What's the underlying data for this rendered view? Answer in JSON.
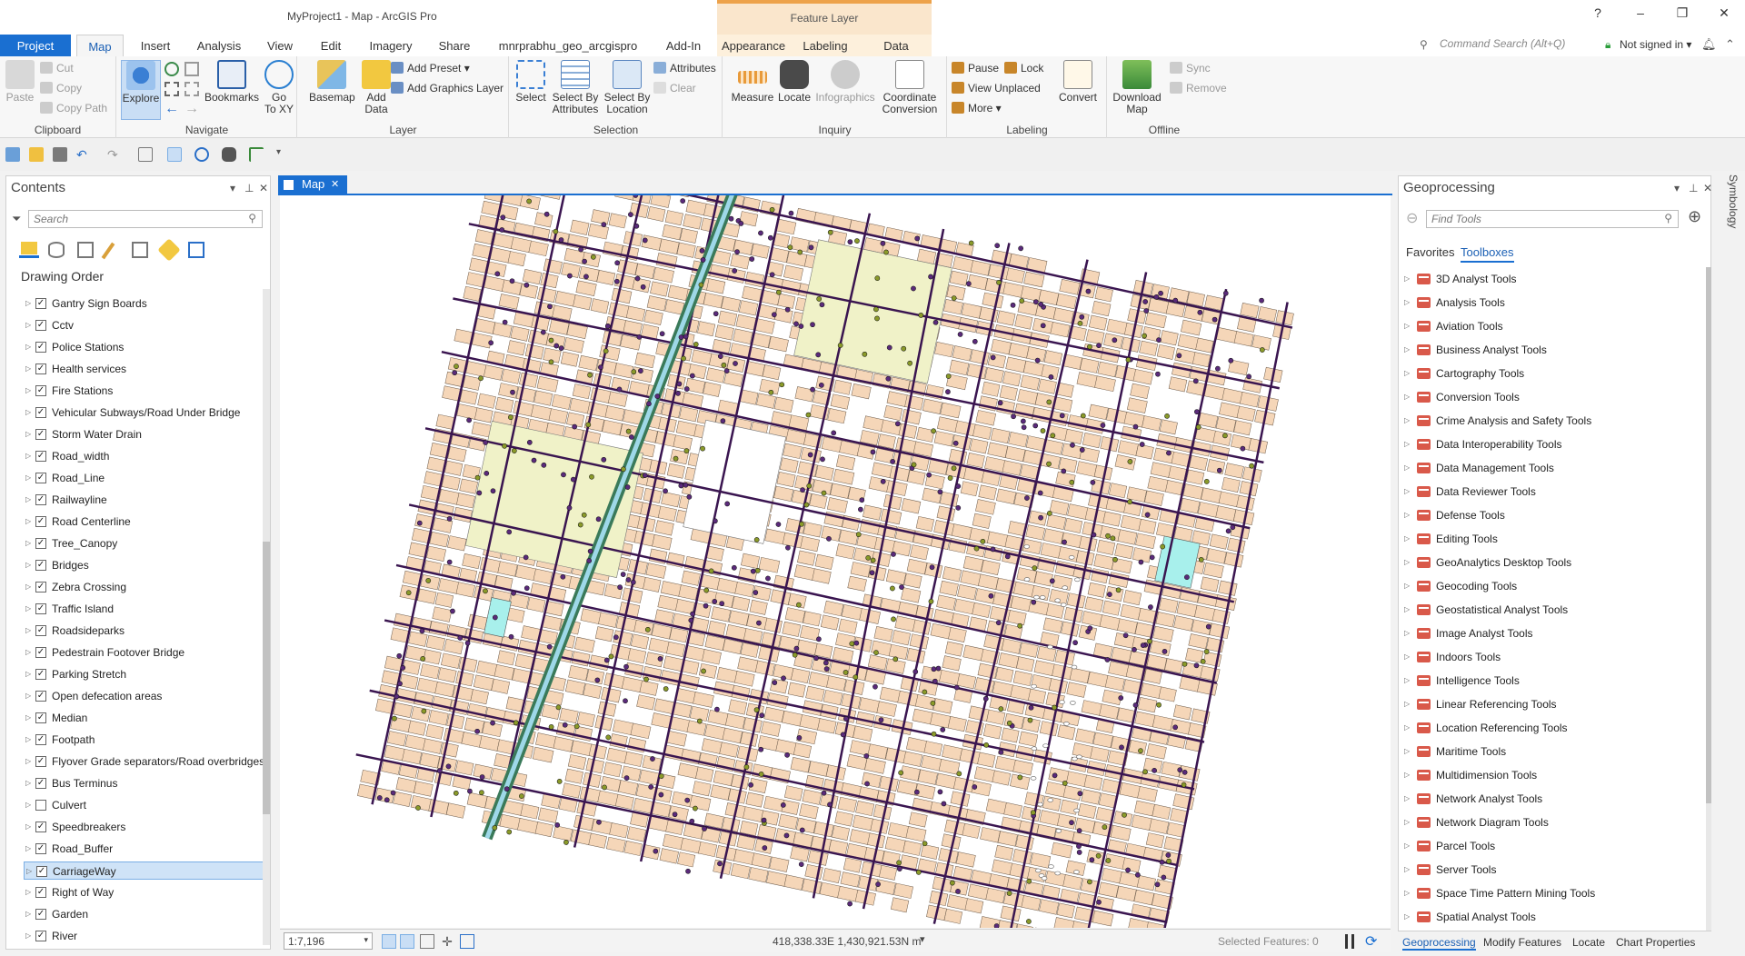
{
  "window": {
    "title": "MyProject1 - Map - ArcGIS Pro",
    "context_header": "Feature Layer",
    "help": "?",
    "minimize": "–",
    "restore": "❐",
    "close": "✕"
  },
  "tabs": [
    {
      "label": "Project"
    },
    {
      "label": "Map"
    },
    {
      "label": "Insert"
    },
    {
      "label": "Analysis"
    },
    {
      "label": "View"
    },
    {
      "label": "Edit"
    },
    {
      "label": "Imagery"
    },
    {
      "label": "Share"
    },
    {
      "label": "mnrprabhu_geo_arcgispro"
    },
    {
      "label": "Add-In"
    },
    {
      "label": "Appearance"
    },
    {
      "label": "Labeling"
    },
    {
      "label": "Data"
    }
  ],
  "command_search": {
    "placeholder": "Command Search (Alt+Q)"
  },
  "account": {
    "label": "Not signed in"
  },
  "ribbon": {
    "clipboard": {
      "label": "Clipboard",
      "paste": "Paste",
      "cut": "Cut",
      "copy": "Copy",
      "copy_path": "Copy Path"
    },
    "navigate": {
      "label": "Navigate",
      "explore": "Explore",
      "bookmarks": "Bookmarks",
      "go_to_xy": "Go\nTo XY"
    },
    "layer": {
      "label": "Layer",
      "basemap": "Basemap",
      "add_data": "Add\nData",
      "add_preset": "Add Preset",
      "add_graphics_layer": "Add Graphics Layer"
    },
    "selection": {
      "label": "Selection",
      "select": "Select",
      "select_by_attributes": "Select By\nAttributes",
      "select_by_location": "Select By\nLocation",
      "attributes": "Attributes",
      "clear": "Clear"
    },
    "inquiry": {
      "label": "Inquiry",
      "measure": "Measure",
      "locate": "Locate",
      "infographics": "Infographics",
      "coordinate_conversion": "Coordinate\nConversion"
    },
    "labeling": {
      "label": "Labeling",
      "pause": "Pause",
      "lock": "Lock",
      "view_unplaced": "View Unplaced",
      "more": "More",
      "convert": "Convert"
    },
    "offline": {
      "label": "Offline",
      "download_map": "Download\nMap",
      "sync": "Sync",
      "remove": "Remove"
    }
  },
  "contents": {
    "title": "Contents",
    "search_placeholder": "Search",
    "drawing_order": "Drawing Order",
    "layers": [
      {
        "name": "Gantry Sign Boards",
        "checked": true
      },
      {
        "name": "Cctv",
        "checked": true
      },
      {
        "name": "Police Stations",
        "checked": true
      },
      {
        "name": "Health services",
        "checked": true
      },
      {
        "name": "Fire Stations",
        "checked": true
      },
      {
        "name": "Vehicular Subways/Road Under Bridge",
        "checked": true
      },
      {
        "name": "Storm Water Drain",
        "checked": true
      },
      {
        "name": "Road_width",
        "checked": true
      },
      {
        "name": "Road_Line",
        "checked": true
      },
      {
        "name": "Railwayline",
        "checked": true
      },
      {
        "name": "Road Centerline",
        "checked": true
      },
      {
        "name": "Tree_Canopy",
        "checked": true
      },
      {
        "name": "Bridges",
        "checked": true
      },
      {
        "name": "Zebra Crossing",
        "checked": true
      },
      {
        "name": "Traffic Island",
        "checked": true
      },
      {
        "name": "Roadsideparks",
        "checked": true
      },
      {
        "name": "Pedestrain Footover Bridge",
        "checked": true
      },
      {
        "name": "Parking Stretch",
        "checked": true
      },
      {
        "name": "Open defecation areas",
        "checked": true
      },
      {
        "name": "Median",
        "checked": true
      },
      {
        "name": "Footpath",
        "checked": true
      },
      {
        "name": "Flyover Grade separators/Road overbridges",
        "checked": true
      },
      {
        "name": "Bus Terminus",
        "checked": true
      },
      {
        "name": "Culvert",
        "checked": false
      },
      {
        "name": "Speedbreakers",
        "checked": true
      },
      {
        "name": "Road_Buffer",
        "checked": true
      },
      {
        "name": "CarriageWay",
        "checked": true,
        "selected": true
      },
      {
        "name": "Right of Way",
        "checked": true
      },
      {
        "name": "Garden",
        "checked": true
      },
      {
        "name": "River",
        "checked": true
      }
    ]
  },
  "map": {
    "tab_label": "Map",
    "scale": "1:7,196",
    "coordinates": "418,338.33E 1,430,921.53N m",
    "selected_features": "Selected Features: 0"
  },
  "geoprocessing": {
    "title": "Geoprocessing",
    "side_tab": "Symbology",
    "search_placeholder": "Find Tools",
    "tab_favorites": "Favorites",
    "tab_toolboxes": "Toolboxes",
    "toolboxes": [
      "3D Analyst Tools",
      "Analysis Tools",
      "Aviation Tools",
      "Business Analyst Tools",
      "Cartography Tools",
      "Conversion Tools",
      "Crime Analysis and Safety Tools",
      "Data Interoperability Tools",
      "Data Management Tools",
      "Data Reviewer Tools",
      "Defense Tools",
      "Editing Tools",
      "GeoAnalytics Desktop Tools",
      "Geocoding Tools",
      "Geostatistical Analyst Tools",
      "Image Analyst Tools",
      "Indoors Tools",
      "Intelligence Tools",
      "Linear Referencing Tools",
      "Location Referencing Tools",
      "Maritime Tools",
      "Multidimension Tools",
      "Network Analyst Tools",
      "Network Diagram Tools",
      "Parcel Tools",
      "Server Tools",
      "Space Time Pattern Mining Tools",
      "Spatial Analyst Tools"
    ]
  },
  "bottom_tabs": [
    "Geoprocessing",
    "Modify Features",
    "Locate",
    "Chart Properties"
  ],
  "colors": {
    "accent": "#1a6fd1",
    "parcel_fill": "#f5d6b8",
    "road_purple": "#3a1550",
    "park_fill": "#f0f2c8",
    "water": "#a8f0ec"
  }
}
